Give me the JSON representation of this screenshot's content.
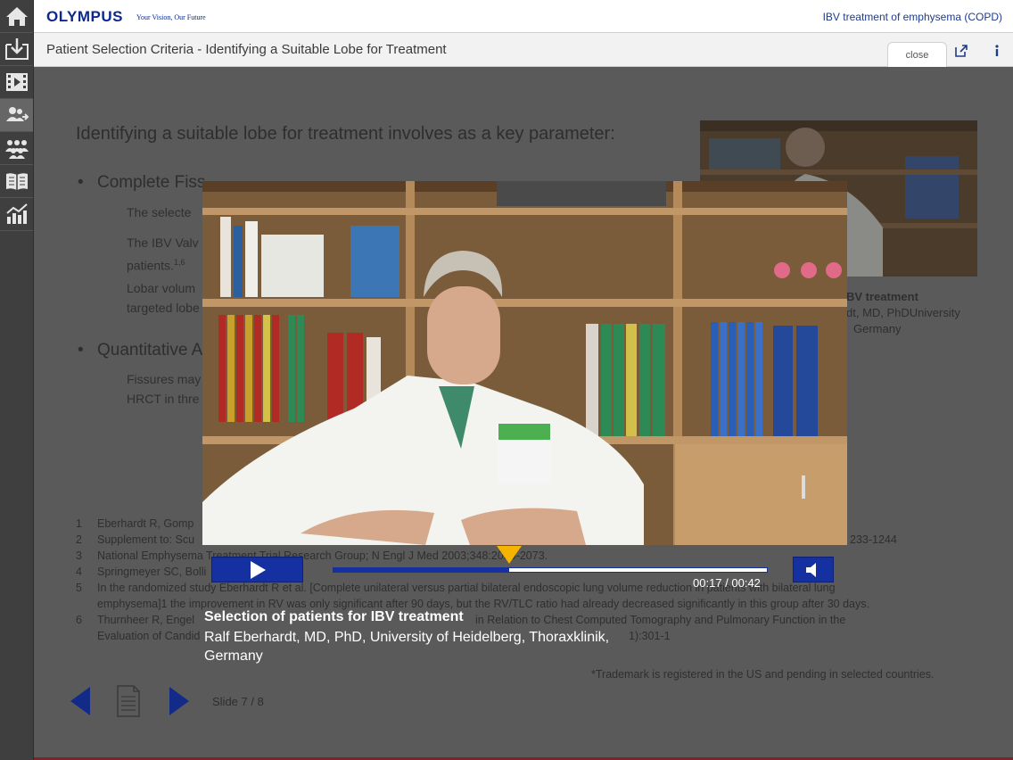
{
  "header": {
    "logo": "OLYMPUS",
    "tagline": "Your Vision, Our Future",
    "app_title": "IBV treatment of emphysema (COPD)"
  },
  "sidebar": {
    "items": [
      {
        "icon": "home-icon"
      },
      {
        "icon": "download-icon"
      },
      {
        "icon": "film-icon"
      },
      {
        "icon": "patient-selection-icon"
      },
      {
        "icon": "group-icon"
      },
      {
        "icon": "book-icon"
      },
      {
        "icon": "chart-icon"
      }
    ]
  },
  "titlebar": {
    "title": "Patient Selection Criteria - Identifying a Suitable Lobe for Treatment",
    "close_label": "close"
  },
  "slide": {
    "heading": "Identifying a suitable lobe for treatment involves as a key parameter:",
    "bullet1": "Complete Fiss",
    "para1": "The selecte",
    "para2a": "The IBV Valv",
    "para2b": "patients.",
    "para2b_sup": "1,6",
    "para3a": "Lobar volum",
    "para3b": "targeted lobe",
    "bullet2": "Quantitative A",
    "para4a": "Fissures may",
    "para4b": "HRCT in thre",
    "caption1": "BV treatment",
    "caption2": "dt, MD, PhDUniversity",
    "caption3": "Germany",
    "references": [
      {
        "num": "1",
        "text": "Eberhardt R, Gomp"
      },
      {
        "num": "2",
        "text": "Supplement to: Scu"
      },
      {
        "num": "3",
        "text": "National Emphysema Treatment Trial Research Group; N Engl J Med 2003;348:2059-2073."
      },
      {
        "num": "4",
        "text": "Springmeyer SC, Bolli"
      },
      {
        "num": "5",
        "text": "In the randomized study Eberhardt R et al. [Complete unilateral versus partial bilateral endoscopic lung volume reduction in patients with bilateral lung"
      },
      {
        "num": "",
        "text": "emphysema]1 the improvement in RV was only significant after 90 days, but the RV/TLC ratio had already decreased significantly in this group after 30 days."
      },
      {
        "num": "6",
        "text": "Thurnheer R, Engel"
      },
      {
        "num": "",
        "text": "Evaluation of Candid"
      }
    ],
    "ref2_tail": "233-1244",
    "ref6_tail": "in Relation to Chest Computed Tomography and Pulmonary Function in the",
    "ref6b_tail": "1):301-1",
    "trademark": "*Trademark is registered in the US and pending in selected countries.",
    "counter": "Slide 7 / 8"
  },
  "video": {
    "current_time": "00:17",
    "duration": "00:42",
    "timecode": "00:17 / 00:42",
    "progress": 0.405,
    "caption_title": "Selection of patients for IBV treatment",
    "caption_sub": "Ralf Eberhardt, MD, PhD, University of Heidelberg, Thoraxklinik, Germany"
  },
  "colors": {
    "brand_blue": "#1530a0",
    "scrubber": "#f4b400",
    "sidebar": "#3f3f3f"
  }
}
